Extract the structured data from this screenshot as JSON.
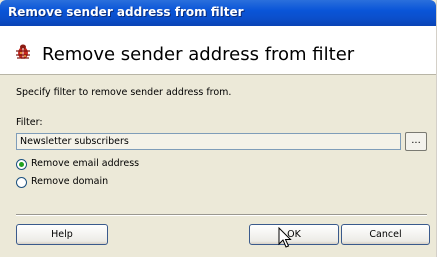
{
  "window": {
    "title": "Remove sender address from filter"
  },
  "header": {
    "title": "Remove sender address from filter",
    "icon": "bug-filter-icon"
  },
  "instructions": "Specify filter to remove sender address from.",
  "filter": {
    "label": "Filter:",
    "value": "Newsletter subscribers",
    "browse_label": "..."
  },
  "options": [
    {
      "label": "Remove email address",
      "selected": true
    },
    {
      "label": "Remove domain",
      "selected": false
    }
  ],
  "buttons": {
    "help": "Help",
    "ok": "OK",
    "cancel": "Cancel"
  },
  "colors": {
    "title_bar": "#0a55d8",
    "dialog_bg": "#ece9d8",
    "radio_selected": "#21a121"
  }
}
